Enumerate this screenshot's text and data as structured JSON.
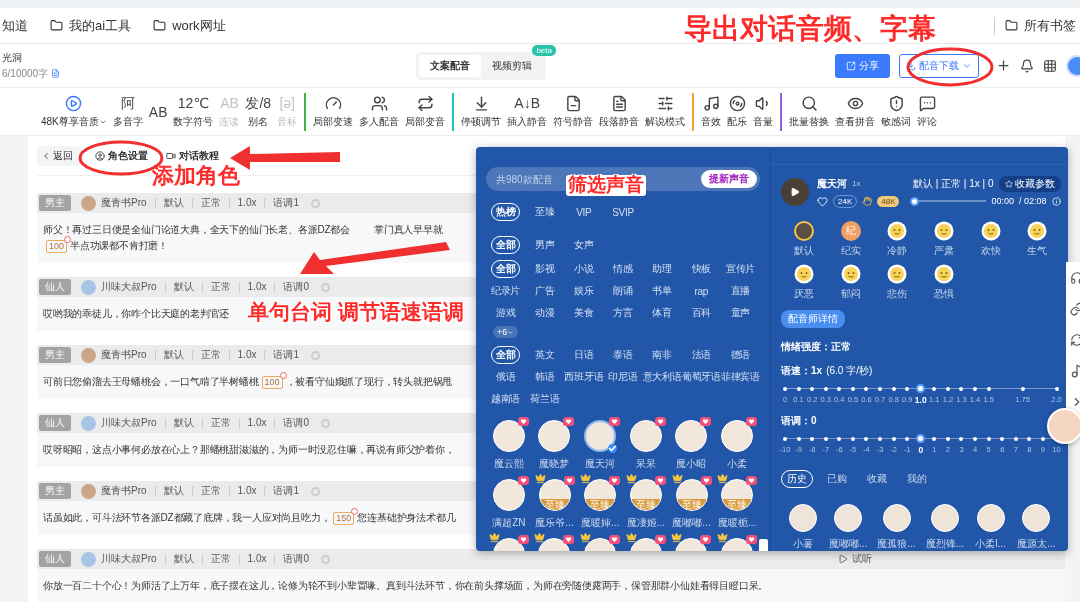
{
  "browser": {
    "bookmarks": [
      {
        "label": "知道"
      },
      {
        "label": "我的ai工具"
      },
      {
        "label": "work网址"
      }
    ],
    "all_bookmarks": "所有书签"
  },
  "header": {
    "doc_title": "光洞",
    "word_count": "6/10000字",
    "tabs": [
      {
        "label": "文案配音",
        "selected": true
      },
      {
        "label": "视频剪辑",
        "selected": false,
        "badge": "beta"
      }
    ],
    "share": "分享",
    "download": "配音下载"
  },
  "toolbar": [
    {
      "items": [
        {
          "label": "48K尊享音质",
          "disabled": false,
          "caret": true
        },
        {
          "glyph": "阿",
          "label": "多音字",
          "disabled": false
        },
        {
          "glyph": "AB",
          "disabled": false
        },
        {
          "glyph": "12℃",
          "label": "数字符号",
          "disabled": false
        },
        {
          "glyph": "AB",
          "label": "连读",
          "disabled": true
        },
        {
          "glyph": "发/8",
          "label": "别名",
          "disabled": false
        },
        {
          "glyph": "[ə]",
          "label": "音标",
          "disabled": true
        }
      ]
    },
    {
      "items": [
        {
          "label": "局部变速",
          "disabled": false
        },
        {
          "label": "多人配音",
          "disabled": false
        },
        {
          "label": "局部变音",
          "disabled": false
        }
      ]
    },
    {
      "items": [
        {
          "label": "停顿调节",
          "disabled": false
        },
        {
          "glyph": "A↓B",
          "label": "插入静音",
          "disabled": false
        },
        {
          "label": "符号静音",
          "disabled": false
        },
        {
          "label": "段落静音",
          "disabled": false
        },
        {
          "label": "解说模式",
          "disabled": false
        }
      ]
    },
    {
      "items": [
        {
          "label": "音效",
          "disabled": false
        },
        {
          "label": "配乐",
          "disabled": false
        },
        {
          "label": "音量",
          "disabled": false
        }
      ]
    },
    {
      "items": [
        {
          "label": "批量替换",
          "disabled": false
        },
        {
          "label": "查看拼音",
          "disabled": false
        },
        {
          "label": "敏感词",
          "disabled": false
        },
        {
          "label": "评论",
          "disabled": false
        }
      ]
    }
  ],
  "subbar": {
    "back": "返回",
    "roles": "角色设置",
    "tutorial": "对话教程"
  },
  "rows": [
    {
      "role": "男主",
      "voice": "魔青书Pro",
      "emotion": "默认",
      "intensity": "正常",
      "speed": "1.0x",
      "pitch": "语调1",
      "lines": [
        [
          {
            "kind": "text",
            "text": "师父！再过三日便是全仙门论道大典，全天下的仙门长老、各派DZ都会"
          },
          {
            "kind": "text",
            "text": "掌门真人早早就"
          }
        ],
        [
          {
            "kind": "pause",
            "text": "100"
          },
          {
            "kind": "text",
            "text": "半点功课都不肯打磨！"
          }
        ]
      ]
    },
    {
      "role": "仙人",
      "voice": "川味大叔Pro",
      "emotion": "默认",
      "intensity": "正常",
      "speed": "1.0x",
      "pitch": "语调0",
      "lines": [
        [
          {
            "kind": "text",
            "text": "哎哟我的乖徒儿，你咋个比天庭的老判官还"
          }
        ]
      ]
    },
    {
      "role": "男主",
      "voice": "魔青书Pro",
      "emotion": "默认",
      "intensity": "正常",
      "speed": "1.0x",
      "pitch": "语调1",
      "lines": [
        [
          {
            "kind": "text",
            "text": "可前日您偷溜去王母蟠桃会，一口气啃了半树蟠桃"
          },
          {
            "kind": "pause",
            "text": "100"
          },
          {
            "kind": "text",
            "text": "，被看守仙娥抓了现行，转头就把锅甩"
          }
        ]
      ]
    },
    {
      "role": "仙人",
      "voice": "川味大叔Pro",
      "emotion": "默认",
      "intensity": "正常",
      "speed": "1.0x",
      "pitch": "语调0",
      "lines": [
        [
          {
            "kind": "text",
            "text": "哎呀昭昭，这点小事何必放在心上？那蟠桃甜滋滋的，为师一时没忍住嘛，再说有师父护着你，"
          }
        ]
      ]
    },
    {
      "role": "男主",
      "voice": "魔青书Pro",
      "emotion": "默认",
      "intensity": "正常",
      "speed": "1.0x",
      "pitch": "语调1",
      "lines": [
        [
          {
            "kind": "text",
            "text": "话虽如此，可斗法环节各派DZ都藏了底牌，我一人应对尚且吃力，"
          },
          {
            "kind": "pause",
            "text": "150"
          },
          {
            "kind": "text",
            "text": "您连基础护身法术都几"
          }
        ]
      ]
    },
    {
      "role": "仙人",
      "voice": "川味大叔Pro",
      "emotion": "默认",
      "intensity": "正常",
      "speed": "1.0x",
      "pitch": "语调0",
      "preview": "试听",
      "lines": [
        [
          {
            "kind": "text",
            "text": "你放一百二十个心！为师活了上万年，底子摆在这儿，论修为轮不到小辈置喙。真到斗法环节，你在前头撑场面，为师在旁随便露两手，保管那群小仙娃看得目瞪口呆。"
          }
        ]
      ]
    }
  ],
  "voice_panel": {
    "search_placeholder": "共980款配音",
    "create_button": "提新声音",
    "tiers": [
      {
        "label": "热榜",
        "selected": true
      },
      {
        "label": "至臻",
        "selected": false
      },
      {
        "label": "VIP",
        "selected": false
      },
      {
        "label": "SVIP",
        "selected": false
      }
    ],
    "genders": [
      {
        "label": "全部",
        "selected": true
      },
      {
        "label": "男声",
        "selected": false
      },
      {
        "label": "女声",
        "selected": false
      }
    ],
    "categories": [
      {
        "label": "全部",
        "selected": true
      },
      {
        "label": "影视",
        "selected": false
      },
      {
        "label": "小说",
        "selected": false
      },
      {
        "label": "情感",
        "selected": false
      },
      {
        "label": "助理",
        "selected": false
      },
      {
        "label": "快板",
        "selected": false
      },
      {
        "label": "宣传片",
        "selected": false
      },
      {
        "label": "纪录片",
        "selected": false
      },
      {
        "label": "广告",
        "selected": false
      },
      {
        "label": "娱乐",
        "selected": false
      },
      {
        "label": "朗诵",
        "selected": false
      },
      {
        "label": "书单",
        "selected": false
      },
      {
        "label": "rap",
        "selected": false
      },
      {
        "label": "直播",
        "selected": false
      },
      {
        "label": "游戏",
        "selected": false
      },
      {
        "label": "动漫",
        "selected": false
      },
      {
        "label": "美食",
        "selected": false
      },
      {
        "label": "方言",
        "selected": false
      },
      {
        "label": "体育",
        "selected": false
      },
      {
        "label": "百科",
        "selected": false
      },
      {
        "label": "童声",
        "selected": false
      }
    ],
    "more_categories": "+6",
    "languages": [
      {
        "label": "全部",
        "selected": true
      },
      {
        "label": "英文",
        "selected": false
      },
      {
        "label": "日语",
        "selected": false
      },
      {
        "label": "泰语",
        "selected": false
      },
      {
        "label": "南非",
        "selected": false
      },
      {
        "label": "法语",
        "selected": false
      },
      {
        "label": "德语",
        "selected": false
      },
      {
        "label": "俄语",
        "selected": false
      },
      {
        "label": "韩语",
        "selected": false
      },
      {
        "label": "西班牙语",
        "selected": false
      },
      {
        "label": "印尼语",
        "selected": false
      },
      {
        "label": "意大利语",
        "selected": false
      },
      {
        "label": "葡萄牙语",
        "selected": false
      },
      {
        "label": "菲律宾语",
        "selected": false
      },
      {
        "label": "越南语",
        "selected": false
      },
      {
        "label": "荷兰语",
        "selected": false
      }
    ],
    "voices": [
      {
        "name": "魔云熙",
        "selected": false,
        "crowned": false
      },
      {
        "name": "魔晓梦",
        "selected": false,
        "crowned": false
      },
      {
        "name": "魔天河",
        "selected": true,
        "crowned": false
      },
      {
        "name": "呆呆",
        "selected": false,
        "crowned": false
      },
      {
        "name": "魔小昭",
        "selected": false,
        "crowned": false
      },
      {
        "name": "小柔",
        "selected": false,
        "crowned": false
      },
      {
        "name": "满超ZN",
        "selected": false,
        "crowned": false
      },
      {
        "name": "魔乐爷...",
        "selected": false,
        "crowned": true,
        "tier_label": "至臻"
      },
      {
        "name": "魔暖婶...",
        "selected": false,
        "crowned": true,
        "tier_label": "至臻"
      },
      {
        "name": "魔凄姬...",
        "selected": false,
        "crowned": true,
        "tier_label": "至臻"
      },
      {
        "name": "魔嘟嘟...",
        "selected": false,
        "crowned": true,
        "tier_label": "至臻"
      },
      {
        "name": "魔暖栀...",
        "selected": false,
        "crowned": true,
        "tier_label": "至臻"
      },
      {
        "selected": false,
        "crowned": true
      },
      {
        "selected": false,
        "crowned": true
      },
      {
        "selected": false,
        "crowned": true
      },
      {
        "selected": false,
        "crowned": true
      },
      {
        "selected": false,
        "crowned": true
      },
      {
        "selected": false,
        "crowned": true
      }
    ],
    "detail": {
      "name": "魔天河",
      "speed_badge": "1x",
      "likes": "24K",
      "quality": "48K",
      "summary": "默认 | 正常 | 1x | 0",
      "save_params": "收藏参数",
      "playback": {
        "level": 0,
        "current": "00:00",
        "total": "/ 02:08"
      },
      "emotions": [
        {
          "label": "默认",
          "kind": "photo",
          "selected": true
        },
        {
          "label": "纪实",
          "kind": "glyph",
          "glyph": "纪",
          "selected": false
        },
        {
          "label": "冷静",
          "kind": "face",
          "selected": false
        },
        {
          "label": "严肃",
          "kind": "face",
          "selected": false
        },
        {
          "label": "欢快",
          "kind": "face",
          "selected": false
        },
        {
          "label": "生气",
          "kind": "face",
          "selected": false
        },
        {
          "label": "厌恶",
          "kind": "face",
          "selected": false
        },
        {
          "label": "郁闷",
          "kind": "face",
          "selected": false
        },
        {
          "label": "悲伤",
          "kind": "face",
          "selected": false
        },
        {
          "label": "恐惧",
          "kind": "face",
          "selected": false
        }
      ],
      "profile_button": "配音师详情",
      "intensity": "情绪强度：正常",
      "speed": {
        "label": "语速：1x",
        "note": "(6.0 字/秒)",
        "level": 0.5,
        "ticks": [
          {
            "label": "0",
            "selected": false
          },
          {
            "label": "0.1",
            "selected": false
          },
          {
            "label": "0.2",
            "selected": false
          },
          {
            "label": "0.3",
            "selected": false
          },
          {
            "label": "0.4",
            "selected": false
          },
          {
            "label": "0.5",
            "selected": false
          },
          {
            "label": "0.6",
            "selected": false
          },
          {
            "label": "0.7",
            "selected": false
          },
          {
            "label": "0.8",
            "selected": false
          },
          {
            "label": "0.9",
            "selected": false
          },
          {
            "label": "1.0",
            "selected": true
          },
          {
            "label": "1.1",
            "selected": false
          },
          {
            "label": "1.2",
            "selected": false
          },
          {
            "label": "1.3",
            "selected": false
          },
          {
            "label": "1.4",
            "selected": false
          },
          {
            "label": "1.5",
            "selected": false
          },
          {
            "label": "1.75",
            "selected": false
          },
          {
            "label": "2.0",
            "selected": false
          }
        ]
      },
      "pitch": {
        "label": "语调：0",
        "level": 0.5,
        "ticks": [
          {
            "label": "-10",
            "selected": false
          },
          {
            "label": "-9",
            "selected": false
          },
          {
            "label": "-8",
            "selected": false
          },
          {
            "label": "-7",
            "selected": false
          },
          {
            "label": "-6",
            "selected": false
          },
          {
            "label": "-5",
            "selected": false
          },
          {
            "label": "-4",
            "selected": false
          },
          {
            "label": "-3",
            "selected": false
          },
          {
            "label": "-2",
            "selected": false
          },
          {
            "label": "-1",
            "selected": false
          },
          {
            "label": "0",
            "selected": true
          },
          {
            "label": "1",
            "selected": false
          },
          {
            "label": "2",
            "selected": false
          },
          {
            "label": "3",
            "selected": false
          },
          {
            "label": "4",
            "selected": false
          },
          {
            "label": "5",
            "selected": false
          },
          {
            "label": "6",
            "selected": false
          },
          {
            "label": "7",
            "selected": false
          },
          {
            "label": "8",
            "selected": false
          },
          {
            "label": "9",
            "selected": false
          },
          {
            "label": "10",
            "selected": false
          }
        ]
      },
      "history_tabs": [
        {
          "label": "历史",
          "selected": true
        },
        {
          "label": "已购",
          "selected": false
        },
        {
          "label": "收藏",
          "selected": false
        },
        {
          "label": "我的",
          "selected": false
        }
      ],
      "history": [
        {
          "name": "小薯"
        },
        {
          "name": "魔嘟嘟..."
        },
        {
          "name": "魔孤狼..."
        },
        {
          "name": "魔烈锋..."
        },
        {
          "name": "小柔l..."
        },
        {
          "name": "魔源太..."
        }
      ]
    }
  },
  "annotations": [
    "导出对话音频、字幕",
    "添加角色",
    "单句台词 调节语速语调",
    "筛选声音"
  ]
}
